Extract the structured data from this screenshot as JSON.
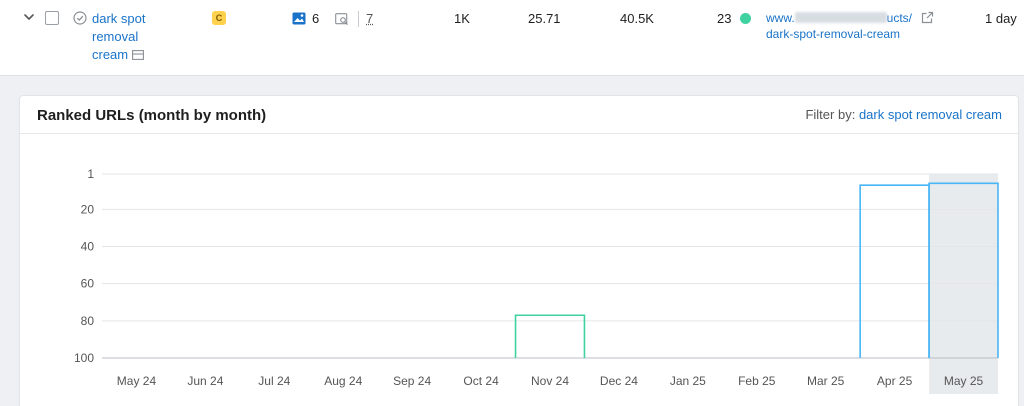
{
  "row": {
    "keyword": "dark spot removal cream",
    "intent": "C",
    "image_count": "6",
    "more_count": "7",
    "volume": "1K",
    "kd": "25.71",
    "traffic": "40.5K",
    "position": "23",
    "url_prefix": "www.",
    "url_rest": "ucts/dark-spot-removal-cream",
    "updated": "1 day",
    "colors": {
      "position_dot": "#3fd1a0",
      "intent_badge": "#ffd24d",
      "link": "#1a73c8"
    }
  },
  "card": {
    "title": "Ranked URLs (month by month)",
    "filter_label": "Filter by:",
    "filter_value": "dark spot removal cream"
  },
  "chart_data": {
    "type": "line",
    "title": "Ranked URLs (month by month)",
    "xlabel": "",
    "ylabel": "",
    "x": [
      "May 24",
      "Jun 24",
      "Jul 24",
      "Aug 24",
      "Sep 24",
      "Oct 24",
      "Nov 24",
      "Dec 24",
      "Jan 25",
      "Feb 25",
      "Mar 25",
      "Apr 25",
      "May 25"
    ],
    "yticks": [
      1,
      20,
      40,
      60,
      80,
      100
    ],
    "ylim": [
      1,
      100
    ],
    "y_inverted": true,
    "grid": true,
    "highlighted_category": "May 25",
    "series": [
      {
        "color": "#3fd1a0",
        "step_segments": [
          {
            "from": "Nov 24",
            "to": "Nov 24",
            "value": 77
          }
        ]
      },
      {
        "color": "#49b6f5",
        "step_segments": [
          {
            "from": "Apr 25",
            "to": "Apr 25",
            "value": 7
          },
          {
            "from": "May 25",
            "to": "May 25",
            "value": 6
          }
        ]
      }
    ]
  }
}
